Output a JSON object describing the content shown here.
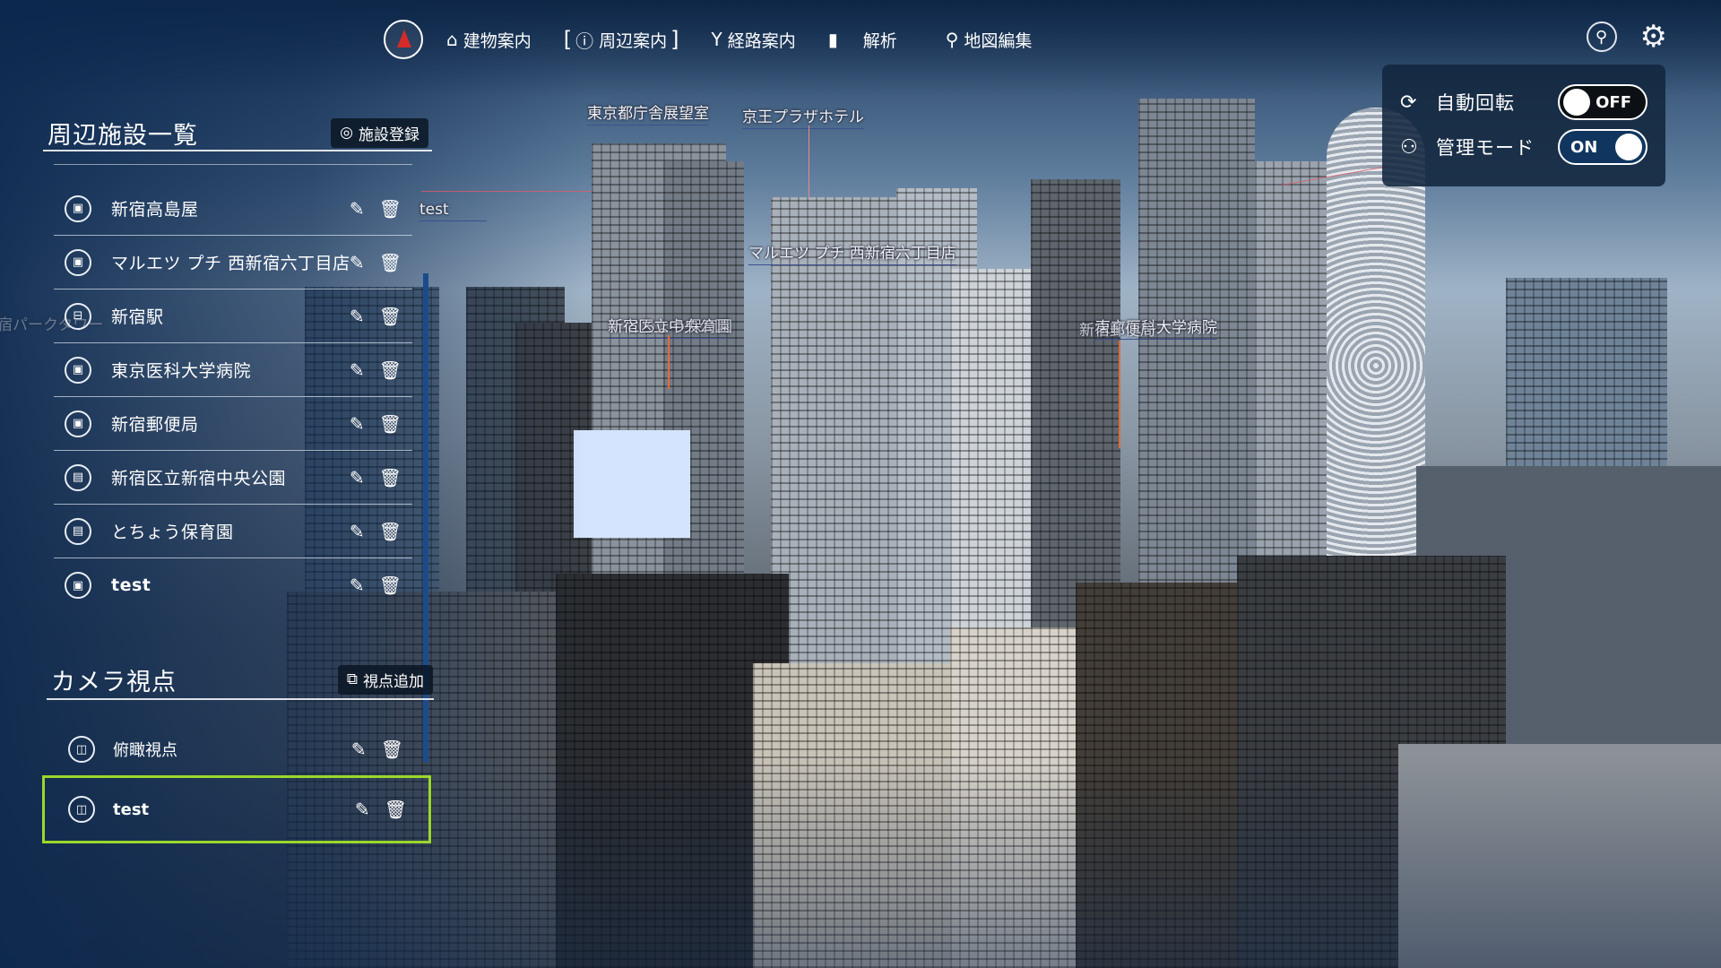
{
  "nav": {
    "items": [
      {
        "icon": "building-icon",
        "glyph": "⌂",
        "label": "建物案内"
      },
      {
        "icon": "info-icon",
        "glyph": "ⓘ",
        "label": "周辺案内"
      },
      {
        "icon": "route-icon",
        "glyph": "Y",
        "label": "経路案内"
      },
      {
        "icon": "analysis-icon",
        "glyph": "▮",
        "label": "解析"
      },
      {
        "icon": "map-edit-icon",
        "glyph": "⚲",
        "label": "地図編集"
      }
    ]
  },
  "toggles": {
    "auto_rotate": {
      "label": "自動回転",
      "state": "OFF"
    },
    "admin_mode": {
      "label": "管理モード",
      "state": "ON"
    }
  },
  "facilities": {
    "title": "周辺施設一覧",
    "register_label": "施設登録",
    "items": [
      {
        "name": "新宿高島屋",
        "icon": "shopping-bag-icon",
        "bold": false
      },
      {
        "name": "マルエツ プチ 西新宿六丁目店",
        "icon": "shopping-bag-icon",
        "bold": false
      },
      {
        "name": "新宿駅",
        "icon": "train-icon",
        "bold": false
      },
      {
        "name": "東京医科大学病院",
        "icon": "shopping-bag-icon",
        "bold": false
      },
      {
        "name": "新宿郵便局",
        "icon": "shopping-bag-icon",
        "bold": false
      },
      {
        "name": "新宿区立新宿中央公園",
        "icon": "building-icon",
        "bold": false
      },
      {
        "name": "とちょう保育園",
        "icon": "building-icon",
        "bold": false
      },
      {
        "name": "test",
        "icon": "shopping-bag-icon",
        "bold": true
      }
    ]
  },
  "camera": {
    "title": "カメラ視点",
    "add_label": "視点追加",
    "items": [
      {
        "name": "俯瞰視点",
        "bold": false,
        "selected": false
      },
      {
        "name": "test",
        "bold": true,
        "selected": true
      }
    ]
  },
  "scene_labels": {
    "tocho": "東京都庁舎展望室",
    "keio": "京王プラザホテル",
    "test": "test",
    "maruetsu": "マルエツ プチ 西新宿六丁目店",
    "park": "新宿区立中央公園",
    "park_overlap": "とちょう保育園",
    "hospital": "東京医科大学病院",
    "post": "新宿郵便局",
    "left_cut": "新宿パークタワー"
  },
  "colors": {
    "accent_select": "#9ad82b",
    "compass_red": "#d52b2b",
    "panel_bg": "#12263e",
    "scroll": "#1a4c8c"
  }
}
